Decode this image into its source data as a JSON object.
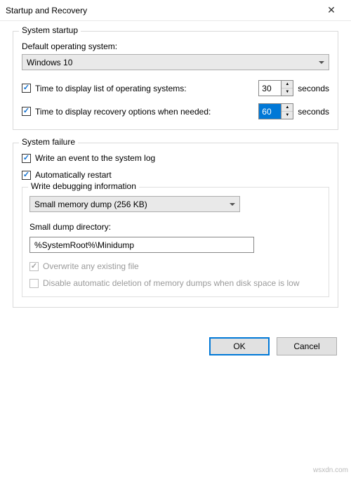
{
  "window": {
    "title": "Startup and Recovery"
  },
  "startup": {
    "legend": "System startup",
    "default_os_label": "Default operating system:",
    "default_os_value": "Windows 10",
    "display_list": {
      "checked": true,
      "label": "Time to display list of operating systems:",
      "value": "30",
      "unit": "seconds"
    },
    "display_recovery": {
      "checked": true,
      "label": "Time to display recovery options when needed:",
      "value": "60",
      "unit": "seconds"
    }
  },
  "failure": {
    "legend": "System failure",
    "write_event": {
      "checked": true,
      "label": "Write an event to the system log"
    },
    "auto_restart": {
      "checked": true,
      "label": "Automatically restart"
    },
    "debug": {
      "legend": "Write debugging information",
      "dump_type": "Small memory dump (256 KB)",
      "dump_dir_label": "Small dump directory:",
      "dump_dir_value": "%SystemRoot%\\Minidump",
      "overwrite": {
        "checked": true,
        "disabled": true,
        "label": "Overwrite any existing file"
      },
      "disable_auto_delete": {
        "checked": false,
        "disabled": true,
        "label": "Disable automatic deletion of memory dumps when disk space is low"
      }
    }
  },
  "buttons": {
    "ok": "OK",
    "cancel": "Cancel"
  },
  "watermark": "wsxdn.com"
}
